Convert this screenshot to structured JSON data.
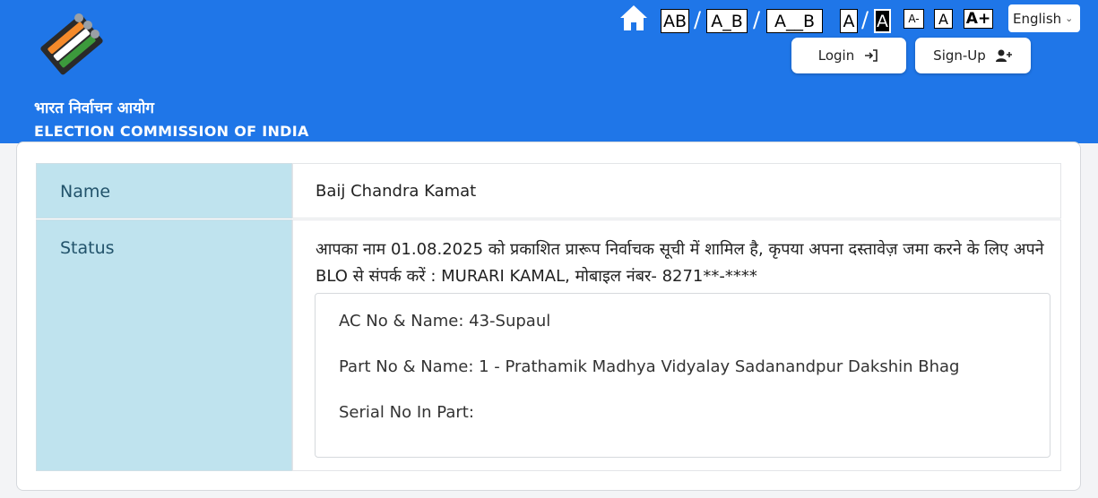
{
  "header": {
    "org_name_hindi": "भारत निर्वाचन आयोग",
    "org_name_english": "ELECTION COMMISSION OF INDIA",
    "logo_icon": "eci-logo-icon",
    "home_icon": "home-icon",
    "bg_color": "#1f76e8"
  },
  "toolbar": {
    "spacing_options": [
      "AB",
      "A_B",
      "A__B"
    ],
    "contrast_options": [
      "A",
      "A"
    ],
    "font_size_options": [
      "A-",
      "A",
      "A+"
    ],
    "separator": "/",
    "language": "English"
  },
  "auth": {
    "login_label": "Login",
    "signup_label": "Sign-Up"
  },
  "record": {
    "name_label": "Name",
    "name_value": "Baij Chandra Kamat",
    "status_label": "Status",
    "status_text": "आपका नाम 01.08.2025 को प्रकाशित प्रारूप निर्वाचक सूची में शामिल है, कृपया अपना दस्तावेज़ जमा करने के लिए अपने BLO से संपर्क करें : MURARI KAMAL, मोबाइल नंबर- 8271**-****",
    "details": {
      "ac": "AC No & Name: 43-Supaul",
      "part": "Part No & Name: 1 - Prathamik Madhya Vidyalay Sadanandpur Dakshin Bhag",
      "serial": "Serial No In Part: "
    }
  }
}
